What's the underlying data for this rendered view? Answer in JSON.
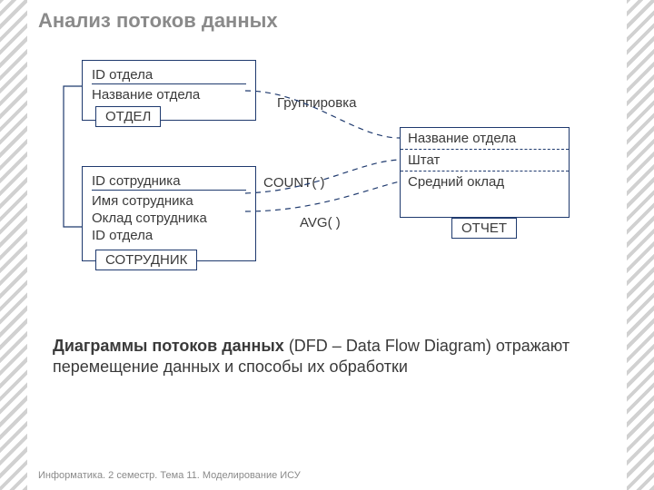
{
  "title": "Анализ потоков данных",
  "entities": [
    {
      "name": "ОТДЕЛ",
      "fields": [
        "ID отдела",
        "Название отдела"
      ]
    },
    {
      "name": "СОТРУДНИК",
      "fields": [
        "ID сотрудника",
        "Имя сотрудника",
        "Оклад сотрудника",
        "ID отдела"
      ]
    }
  ],
  "report": {
    "name": "ОТЧЕТ",
    "rows": [
      "Название отдела",
      "Штат",
      "Средний оклад"
    ]
  },
  "flows": [
    "Группировка",
    "COUNT( )",
    "AVG( )"
  ],
  "caption": {
    "bold": "Диаграммы потоков данных",
    "rest": " (DFD – Data Flow Diagram) отражают перемещение данных и способы их обработки"
  },
  "footer": "Информатика. 2 семестр. Тема 11. Моделирование ИСУ"
}
